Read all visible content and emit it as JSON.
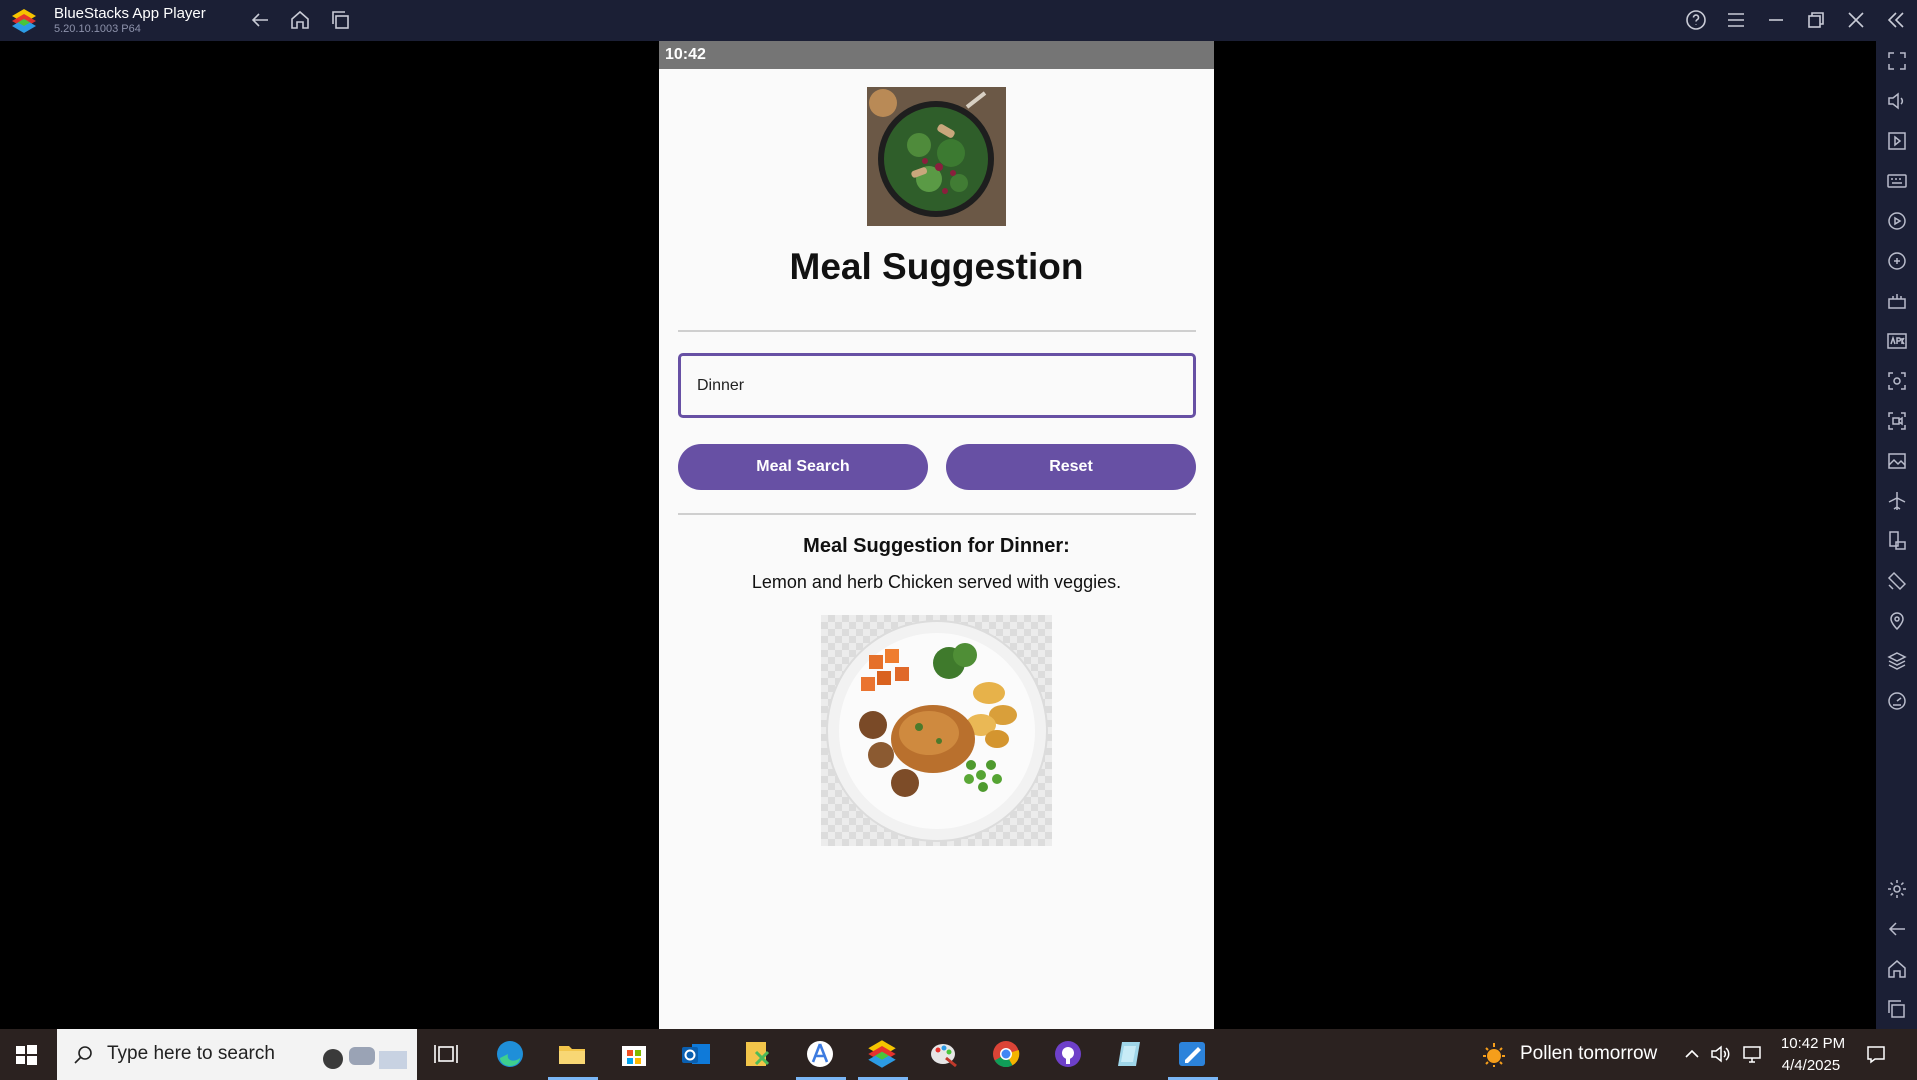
{
  "window": {
    "title": "BlueStacks App Player",
    "version": "5.20.10.1003  P64"
  },
  "android": {
    "status_time": "10:42",
    "page_title": "Meal Suggestion",
    "meal_input": {
      "value": "Dinner"
    },
    "buttons": {
      "search_label": "Meal Search",
      "reset_label": "Reset"
    },
    "result": {
      "title": "Meal Suggestion for Dinner:",
      "text": "Lemon and herb Chicken served with veggies."
    },
    "accent_color": "#6750a4"
  },
  "taskbar": {
    "search_placeholder": "Type here to search",
    "weather_text": "Pollen tomorrow",
    "clock_time": "10:42 PM",
    "clock_date": "4/4/2025"
  }
}
